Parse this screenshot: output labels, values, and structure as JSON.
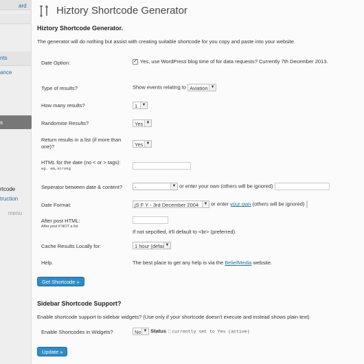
{
  "sidebar": {
    "items": [
      {
        "label": "ard",
        "color": "#2a6da0"
      },
      {
        "label": "nts",
        "color": "#2a6da0"
      },
      {
        "label": "ance",
        "color": "#2a6da0"
      },
      {
        "label": "s",
        "color": "#ffffff"
      },
      {
        "label": "rtcode",
        "color": "#222222"
      },
      {
        "label": "truction",
        "color": "#2a6da0"
      },
      {
        "label": "menu",
        "color": "#999999"
      }
    ]
  },
  "header": {
    "title": "Hiztory Shortcode Generator"
  },
  "generator": {
    "heading": "Hiztory Shortcode Generator.",
    "intro": "The generator will do nothing but assist with creating suitable shortcode for you copy and paste into your website.",
    "date_option_label": "Date Option:",
    "date_option_text": "Yes, use WordPress blog time of for data requests? Currently 7th December 2013.",
    "type_label": "Type of results?",
    "type_prefix": "Show events relating to",
    "type_value": "Aviation",
    "how_many_label": "How many results?",
    "how_many_value": "1",
    "randomise_label": "Randomise Results?",
    "randomise_value": "Yes",
    "return_list_label": "Return results in a list (if more than one)?",
    "return_list_value": "Yes",
    "html_date_label": "HTML for the date (no < or > tags):",
    "html_date_eg": "eg. em,strong",
    "separator_label": "Seperator between date & content?",
    "separator_value": "-",
    "separator_own": "or enter your own (others will be ignored)",
    "date_format_label": "Date Format:",
    "date_format_value": "jS F Y - 3rd December 2004",
    "date_format_or": "or enter",
    "date_format_link": "your own",
    "date_format_suffix": "(others will be ignored)",
    "after_post_label": "After post HTML:",
    "after_post_small": "After post if NOT a list",
    "after_post_note": "If not sepcified, it'll default to <br> (preferred).",
    "cache_label": "Cache Results Locally for:",
    "cache_value": "1 hour (default)",
    "help_label": "Help.",
    "help_prefix": "The best place to get any help is via the",
    "help_link": "BeliefMedia",
    "help_suffix": "website.",
    "get_button": "Get Shortcode »"
  },
  "widgets": {
    "heading": "Sidebar Shortcode Support?",
    "intro": "Enable shortcode support to sidebar widgets? (Use only if your shortcode doesn't execute and instead shows plain text)",
    "enable_label": "Enable Shortcodes in Widgets?",
    "enable_value": "No",
    "status_label": "Status",
    "status_value": "currently set to Yes (active)",
    "update_button": "Update »"
  }
}
